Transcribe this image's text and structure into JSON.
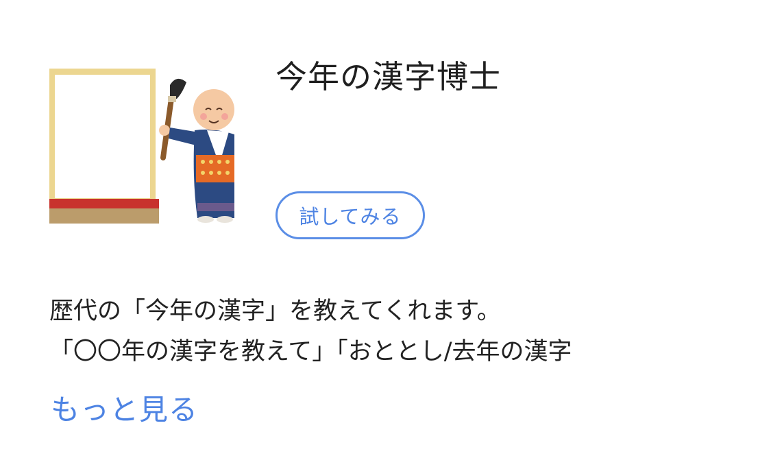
{
  "skill": {
    "icon": "kanji-scroll-monk-icon",
    "title": "今年の漢字博士",
    "try_button_label": "試してみる",
    "description_lines": [
      "歴代の「今年の漢字」を教えてくれます。",
      "「〇〇年の漢字を教えて」「おととし/去年の漢字"
    ],
    "more_link_label": "もっと見る"
  },
  "colors": {
    "accent": "#4d83e3",
    "button_border": "#5b8ee6",
    "title_text": "#1f1f1f",
    "body_text": "#222222"
  }
}
